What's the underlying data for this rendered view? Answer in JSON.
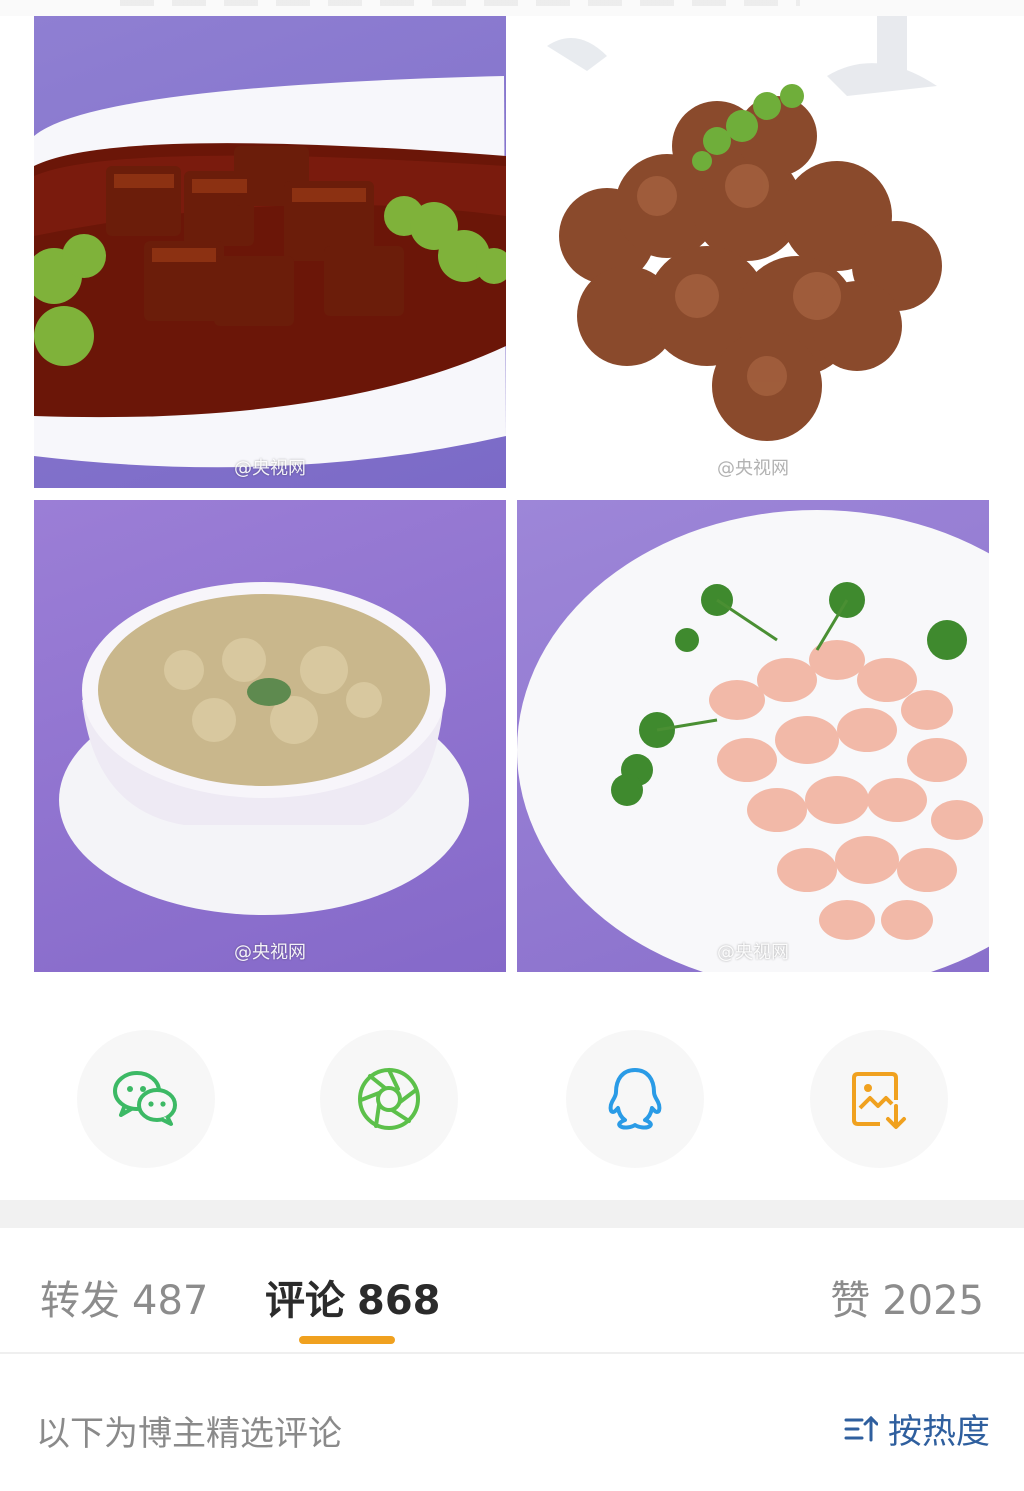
{
  "photos": [
    {
      "watermark": "@央视网"
    },
    {
      "watermark": "@央视网"
    },
    {
      "watermark": "@央视网"
    },
    {
      "watermark": "@央视网"
    }
  ],
  "share": [
    {
      "icon": "wechat-icon",
      "color": "#3cb965"
    },
    {
      "icon": "moments-icon",
      "color": "#5cc04a"
    },
    {
      "icon": "qq-icon",
      "color": "#2a9be6"
    },
    {
      "icon": "save-image-icon",
      "color": "#f0a11f"
    }
  ],
  "tabs": {
    "repost": {
      "label": "转发",
      "count": "487"
    },
    "comment": {
      "label": "评论",
      "count": "868"
    },
    "like": {
      "label": "赞",
      "count": "2025"
    }
  },
  "accent_color": "#f0a11f",
  "filter": {
    "text": "以下为博主精选评论",
    "sort_label": "按热度"
  }
}
